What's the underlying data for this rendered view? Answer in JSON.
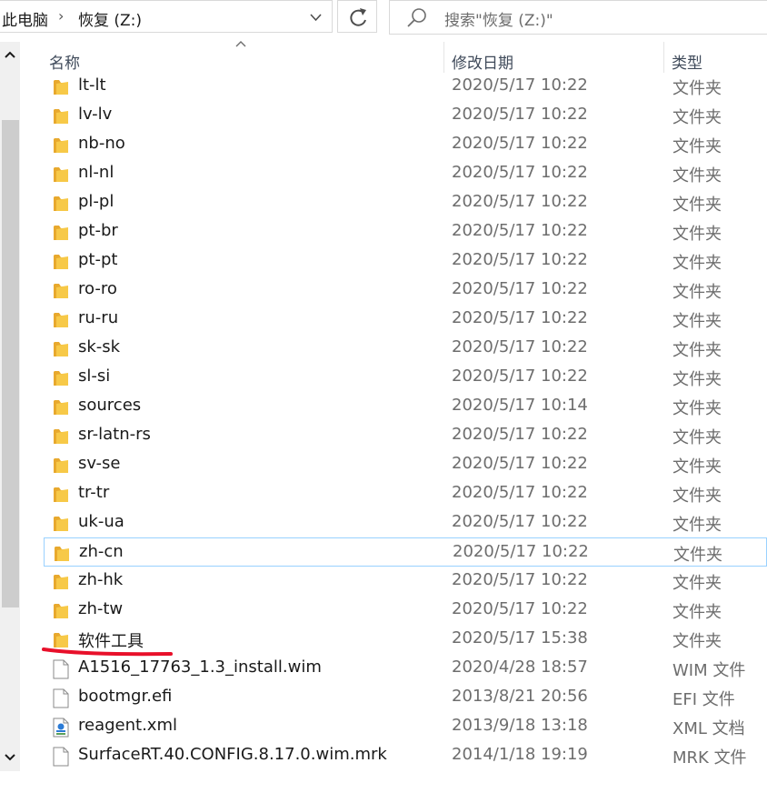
{
  "address": {
    "root": "此电脑",
    "separator": "›",
    "current": "恢复 (Z:)"
  },
  "search": {
    "placeholder": "搜索\"恢复 (Z:)\""
  },
  "columns": {
    "name": "名称",
    "date": "修改日期",
    "type": "类型"
  },
  "colors": {
    "folder": "#f7c948",
    "selection_border": "#99d1ff",
    "annotation": "#e8102a"
  },
  "files": [
    {
      "name": "lt-lt",
      "date": "2020/5/17 10:22",
      "type": "文件夹",
      "icon": "folder-icon"
    },
    {
      "name": "lv-lv",
      "date": "2020/5/17 10:22",
      "type": "文件夹",
      "icon": "folder-icon"
    },
    {
      "name": "nb-no",
      "date": "2020/5/17 10:22",
      "type": "文件夹",
      "icon": "folder-icon"
    },
    {
      "name": "nl-nl",
      "date": "2020/5/17 10:22",
      "type": "文件夹",
      "icon": "folder-icon"
    },
    {
      "name": "pl-pl",
      "date": "2020/5/17 10:22",
      "type": "文件夹",
      "icon": "folder-icon"
    },
    {
      "name": "pt-br",
      "date": "2020/5/17 10:22",
      "type": "文件夹",
      "icon": "folder-icon"
    },
    {
      "name": "pt-pt",
      "date": "2020/5/17 10:22",
      "type": "文件夹",
      "icon": "folder-icon"
    },
    {
      "name": "ro-ro",
      "date": "2020/5/17 10:22",
      "type": "文件夹",
      "icon": "folder-icon"
    },
    {
      "name": "ru-ru",
      "date": "2020/5/17 10:22",
      "type": "文件夹",
      "icon": "folder-icon"
    },
    {
      "name": "sk-sk",
      "date": "2020/5/17 10:22",
      "type": "文件夹",
      "icon": "folder-icon"
    },
    {
      "name": "sl-si",
      "date": "2020/5/17 10:22",
      "type": "文件夹",
      "icon": "folder-icon"
    },
    {
      "name": "sources",
      "date": "2020/5/17 10:14",
      "type": "文件夹",
      "icon": "folder-icon"
    },
    {
      "name": "sr-latn-rs",
      "date": "2020/5/17 10:22",
      "type": "文件夹",
      "icon": "folder-icon"
    },
    {
      "name": "sv-se",
      "date": "2020/5/17 10:22",
      "type": "文件夹",
      "icon": "folder-icon"
    },
    {
      "name": "tr-tr",
      "date": "2020/5/17 10:22",
      "type": "文件夹",
      "icon": "folder-icon"
    },
    {
      "name": "uk-ua",
      "date": "2020/5/17 10:22",
      "type": "文件夹",
      "icon": "folder-icon"
    },
    {
      "name": "zh-cn",
      "date": "2020/5/17 10:22",
      "type": "文件夹",
      "icon": "folder-icon",
      "selected": true
    },
    {
      "name": "zh-hk",
      "date": "2020/5/17 10:22",
      "type": "文件夹",
      "icon": "folder-icon"
    },
    {
      "name": "zh-tw",
      "date": "2020/5/17 10:22",
      "type": "文件夹",
      "icon": "folder-icon"
    },
    {
      "name": "软件工具",
      "date": "2020/5/17 15:38",
      "type": "文件夹",
      "icon": "folder-icon"
    },
    {
      "name": "A1516_17763_1.3_install.wim",
      "date": "2020/4/28 18:57",
      "type": "WIM 文件",
      "icon": "file-icon"
    },
    {
      "name": "bootmgr.efi",
      "date": "2013/8/21 20:56",
      "type": "EFI 文件",
      "icon": "file-icon"
    },
    {
      "name": "reagent.xml",
      "date": "2013/9/18 13:18",
      "type": "XML 文档",
      "icon": "xml-file-icon"
    },
    {
      "name": "SurfaceRT.40.CONFIG.8.17.0.wim.mrk",
      "date": "2014/1/18 19:19",
      "type": "MRK 文件",
      "icon": "file-icon"
    }
  ]
}
